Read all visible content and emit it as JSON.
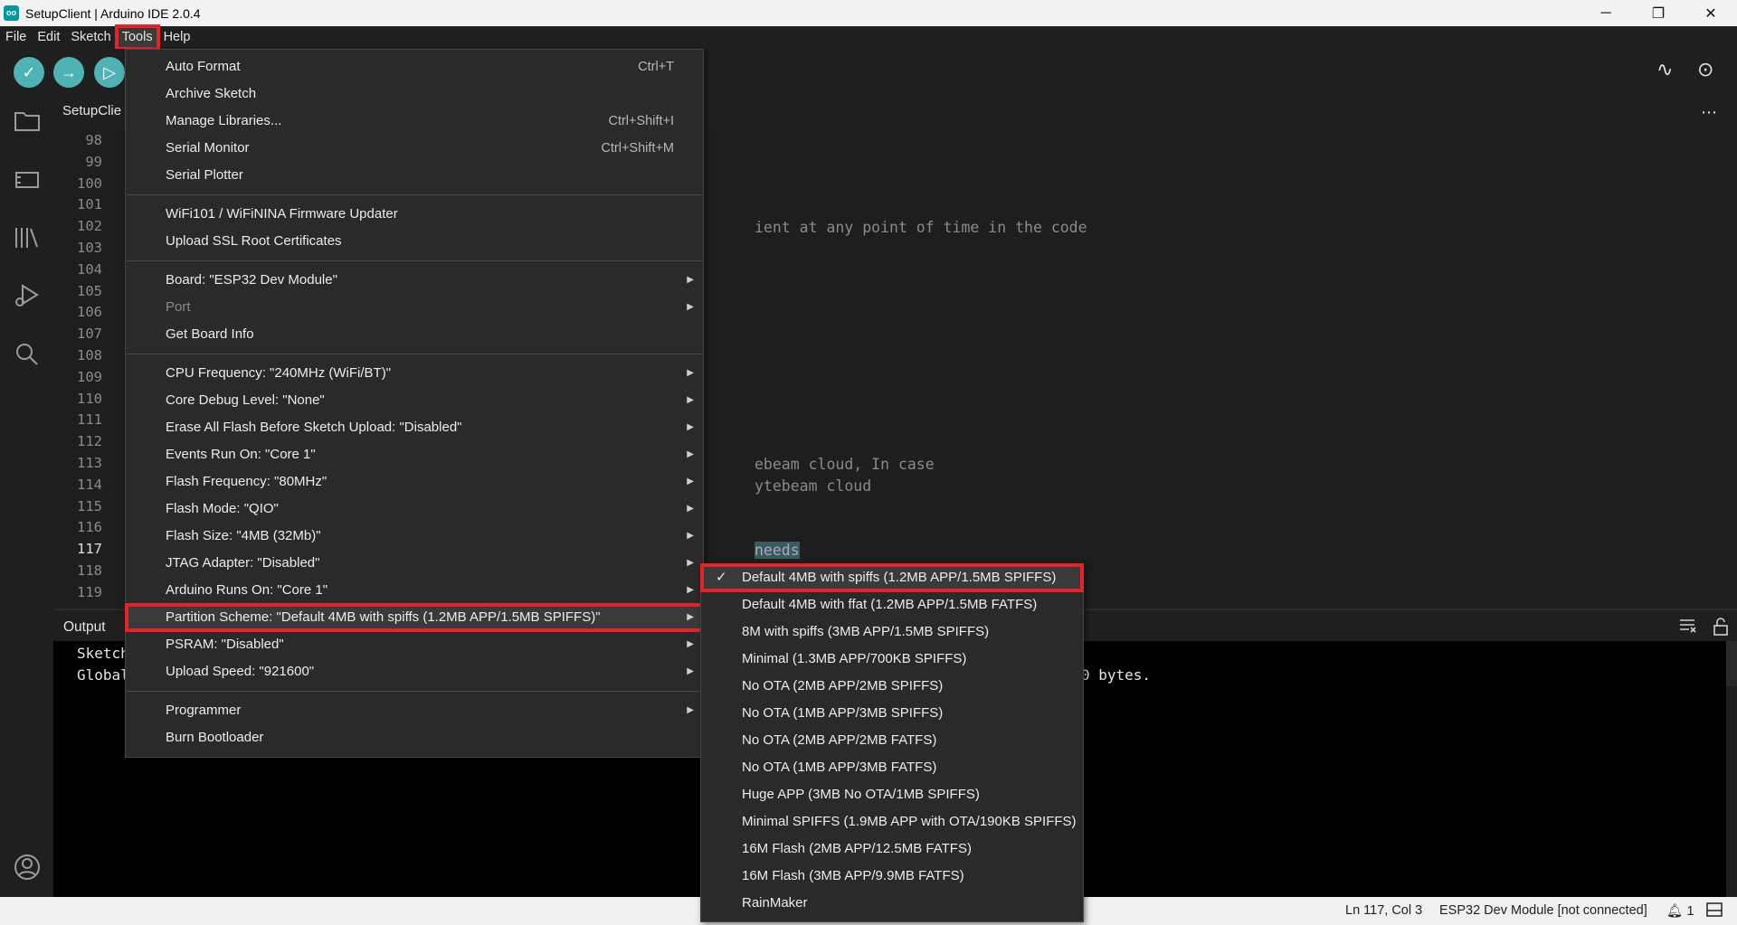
{
  "window": {
    "title": "SetupClient | Arduino IDE 2.0.4",
    "logo_text": "oo",
    "minimize_icon": "─",
    "restore_icon": "❐",
    "close_icon": "✕"
  },
  "menubar": [
    "File",
    "Edit",
    "Sketch",
    "Tools",
    "Help"
  ],
  "toolbar": {
    "verify_icon": "✓",
    "upload_icon": "→",
    "debug_icon": "▷",
    "plotter_icon": "∿",
    "monitor_icon": "⊙"
  },
  "tab": {
    "label": "SetupClie",
    "more_icon": "⋯"
  },
  "editor": {
    "line_numbers": [
      "98",
      "99",
      "100",
      "101",
      "102",
      "103",
      "104",
      "105",
      "106",
      "107",
      "108",
      "109",
      "110",
      "111",
      "112",
      "113",
      "114",
      "115",
      "116",
      "117",
      "118",
      "119"
    ],
    "current_line": "117",
    "visible_code": {
      "line102": "ient at any point of time in the code",
      "line113": "ebeam cloud, In case",
      "line114": "ytebeam cloud",
      "line117": "needs"
    }
  },
  "output": {
    "title": "Output",
    "line1": "Sketch",
    "line2": "Global",
    "line2_tail": "0 bytes."
  },
  "tools_menu": {
    "groups": [
      [
        {
          "label": "Auto Format",
          "shortcut": "Ctrl+T"
        },
        {
          "label": "Archive Sketch",
          "shortcut": ""
        },
        {
          "label": "Manage Libraries...",
          "shortcut": "Ctrl+Shift+I"
        },
        {
          "label": "Serial Monitor",
          "shortcut": "Ctrl+Shift+M"
        },
        {
          "label": "Serial Plotter",
          "shortcut": ""
        }
      ],
      [
        {
          "label": "WiFi101 / WiFiNINA Firmware Updater"
        },
        {
          "label": "Upload SSL Root Certificates"
        }
      ],
      [
        {
          "label": "Board: \"ESP32 Dev Module\"",
          "submenu": true
        },
        {
          "label": "Port",
          "submenu": true,
          "disabled": true
        },
        {
          "label": "Get Board Info"
        }
      ],
      [
        {
          "label": "CPU Frequency: \"240MHz (WiFi/BT)\"",
          "submenu": true
        },
        {
          "label": "Core Debug Level: \"None\"",
          "submenu": true
        },
        {
          "label": "Erase All Flash Before Sketch Upload: \"Disabled\"",
          "submenu": true
        },
        {
          "label": "Events Run On: \"Core 1\"",
          "submenu": true
        },
        {
          "label": "Flash Frequency: \"80MHz\"",
          "submenu": true
        },
        {
          "label": "Flash Mode: \"QIO\"",
          "submenu": true
        },
        {
          "label": "Flash Size: \"4MB (32Mb)\"",
          "submenu": true
        },
        {
          "label": "JTAG Adapter: \"Disabled\"",
          "submenu": true
        },
        {
          "label": "Arduino Runs On: \"Core 1\"",
          "submenu": true
        },
        {
          "label": "Partition Scheme: \"Default 4MB with spiffs (1.2MB APP/1.5MB SPIFFS)\"",
          "submenu": true,
          "highlighted": true
        },
        {
          "label": "PSRAM: \"Disabled\"",
          "submenu": true
        },
        {
          "label": "Upload Speed: \"921600\"",
          "submenu": true
        }
      ],
      [
        {
          "label": "Programmer",
          "submenu": true
        },
        {
          "label": "Burn Bootloader"
        }
      ]
    ]
  },
  "partition_submenu": {
    "items": [
      {
        "label": "Default 4MB with spiffs (1.2MB APP/1.5MB SPIFFS)",
        "checked": true
      },
      {
        "label": "Default 4MB with ffat (1.2MB APP/1.5MB FATFS)"
      },
      {
        "label": "8M with spiffs (3MB APP/1.5MB SPIFFS)"
      },
      {
        "label": "Minimal (1.3MB APP/700KB SPIFFS)"
      },
      {
        "label": "No OTA (2MB APP/2MB SPIFFS)"
      },
      {
        "label": "No OTA (1MB APP/3MB SPIFFS)"
      },
      {
        "label": "No OTA (2MB APP/2MB FATFS)"
      },
      {
        "label": "No OTA (1MB APP/3MB FATFS)"
      },
      {
        "label": "Huge APP (3MB No OTA/1MB SPIFFS)"
      },
      {
        "label": "Minimal SPIFFS (1.9MB APP with OTA/190KB SPIFFS)"
      },
      {
        "label": "16M Flash (2MB APP/12.5MB FATFS)"
      },
      {
        "label": "16M Flash (3MB APP/9.9MB FATFS)"
      },
      {
        "label": "RainMaker"
      }
    ]
  },
  "statusbar": {
    "position": "Ln 117, Col 3",
    "board": "ESP32 Dev Module [not connected]",
    "notifications": "1"
  }
}
